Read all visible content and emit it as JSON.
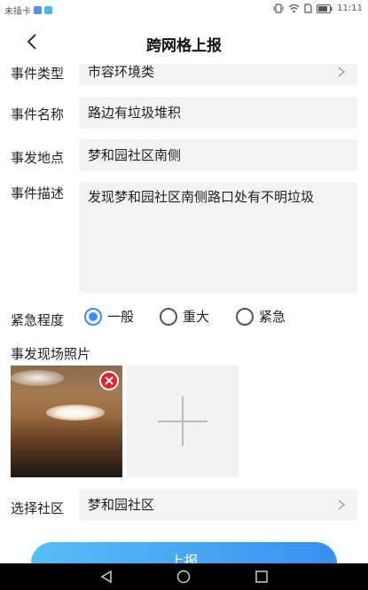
{
  "status_bar": {
    "carrier": "未插卡",
    "time": "11:11"
  },
  "header": {
    "title": "跨网格上报"
  },
  "form": {
    "event_type": {
      "label": "事件类型",
      "value": "市容环境类"
    },
    "event_name": {
      "label": "事件名称",
      "value": "路边有垃圾堆积"
    },
    "location": {
      "label": "事发地点",
      "value": "梦和园社区南侧"
    },
    "description": {
      "label": "事件描述",
      "value": "发现梦和园社区南侧路口处有不明垃圾"
    },
    "urgency": {
      "label": "紧急程度",
      "options": [
        "一般",
        "重大",
        "紧急"
      ],
      "selected": "一般"
    },
    "photos": {
      "label": "事发现场照片"
    },
    "community": {
      "label": "选择社区",
      "value": "梦和园社区"
    }
  },
  "submit_label": "上报",
  "colors": {
    "accent": "#3a8ef6",
    "button_start": "#55bff6",
    "button_end": "#3b8ff0",
    "delete": "#e8202e"
  }
}
